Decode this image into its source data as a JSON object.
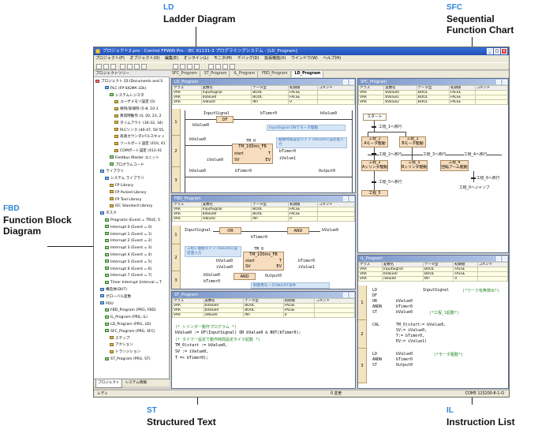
{
  "callouts": {
    "ld": {
      "code": "LD",
      "name": "Ladder Diagram"
    },
    "sfc": {
      "code": "SFC",
      "name_line1": "Sequential",
      "name_line2": "Function Chart"
    },
    "fbd": {
      "code": "FBD",
      "name_line1": "Function Block",
      "name_line2": "Diagram"
    },
    "st": {
      "code": "ST",
      "name": "Structured Text"
    },
    "il": {
      "code": "IL",
      "name": "Instruction List"
    }
  },
  "app": {
    "title": "プロジェクト2.pro - Control FPWIN Pro - IEC 61131-3 プログラミングシステム - [LD_Program]",
    "menu": [
      "プロジェクト(P)",
      "オブジェクト(O)",
      "編集(E)",
      "オンライン(L)",
      "モニタ(M)",
      "デバッグ(D)",
      "拡張機能(X)",
      "ウインドウ(W)",
      "ヘルプ(H)"
    ],
    "panel_title": "プロジェクトツリー",
    "tabs": [
      "SFC_Program",
      "ST_Program",
      "IL_Program",
      "FBD_Program",
      "LD_Program"
    ],
    "active_tab": "LD_Program",
    "tree": [
      "プロジェクト [D:\\Documents and S",
      "PLC (FP-SIGMA 32k)",
      "システムレジスタ",
      "ユーザメモリ設定 (0)",
      "保持/非保持 (5-8, 10-1",
      "異常時動作 (4, 20, 23, 2",
      "タイムアウト (30-32, 34)",
      "PLCリンク (40-47, 50-55,",
      "高速カウンタ/パルスキャッ",
      "ツールポート設定 (410, 41",
      "COMポート設定 (412-41",
      "Fieldbus Master ユニット",
      "プログラムコード",
      "ライブラリ",
      "システム ライブラリ",
      "FP Library",
      "FP Pulsed Library",
      "FP Tool Library",
      "IEC Standard Library",
      "タスク",
      "Programs (Event = TRUE, 5",
      "Interrupt 0 (Event = 0)",
      "Interrupt 1 (Event = 1)",
      "Interrupt 2 (Event = 2)",
      "Interrupt 3 (Event = 3)",
      "Interrupt 4 (Event = 4)",
      "Interrupt 5 (Event = 5)",
      "Interrupt 6 (Event = 6)",
      "Interrupt 7 (Event = 7)",
      "Timer Interrupt (Interval = T",
      "構造体(DUT)",
      "グローバル変数",
      "POU",
      "FBD_Program (PRG, FBD)",
      "IL_Program (PRG, IL)",
      "LD_Program (PRG, LD)",
      "SFC_Program (PRG, SFC)",
      "ステップ",
      "アクション",
      "トランジション",
      "ST_Program (PRG, ST)"
    ],
    "tree_tabs": [
      "プロジェクト",
      "システム情報"
    ],
    "status_left": "レディ",
    "status_mid": "0 変更",
    "status_right": "COM5 115200-8-1-O"
  },
  "var_headers": [
    "クラス",
    "変数名",
    "データ型",
    "初期値",
    "コメント"
  ],
  "ld": {
    "title": "LD_Program",
    "vars": [
      [
        "VAR",
        "InputSignal",
        "BOOL",
        "FALSE",
        ""
      ],
      [
        "VAR",
        "bValue0",
        "BOOL",
        "FALSE",
        ""
      ],
      [
        "VAR",
        "iValue0",
        "INT",
        "0",
        ""
      ]
    ],
    "rungs": [
      "1",
      "2",
      "3"
    ],
    "r1": {
      "a": "InputSignal",
      "fb": "DF",
      "b": "bValue0",
      "c": "bTimer0",
      "out": "bValue0",
      "comment": "InputSignal ONでモータ駆動"
    },
    "r2": {
      "a": "bValue0",
      "fbname": "TM_0",
      "fbtype": "TM_100ms_FB",
      "start": "start",
      "t": "T",
      "sv": "SV",
      "ev": "EV",
      "in": "iValue0",
      "out1": "bTimer0",
      "out2": "iValue1",
      "comment": "駆動時間設定タイマ iValue0に設定値入力"
    },
    "r3": {
      "a": "bValue0",
      "b": "bTimer0",
      "out": "Output0"
    }
  },
  "fbd": {
    "title": "FBD_Program",
    "vars": [
      [
        "VAR",
        "InputSignal",
        "BOOL",
        "FALSE",
        ""
      ],
      [
        "VAR",
        "bValue0",
        "BOOL",
        "FALSE",
        ""
      ],
      [
        "VAR",
        "iValue0",
        "INT",
        "0",
        ""
      ]
    ],
    "rungs": [
      "1",
      "2",
      "3"
    ],
    "r1": {
      "a": "InputSignal",
      "or": "OR",
      "b": "bTimer0",
      "and": "AND",
      "out": "bValue0"
    },
    "r2": {
      "comment": "工程1 駆動タイマ iValue0に設定値入力",
      "fbname": "TM_0",
      "fbtype": "TM_100ms_FB",
      "a": "bValue0",
      "in": "iValue0",
      "start": "start",
      "t": "T",
      "sv": "SV",
      "ev": "EV",
      "out1": "bTimer0",
      "out2": "iValue1"
    },
    "r3": {
      "a": "bValue0",
      "b": "bTimer0",
      "and": "AND",
      "out": "Output0",
      "comment": "制御用モータON/OFF条件"
    }
  },
  "sfc": {
    "title": "SFC_Program",
    "vars": [
      [
        "VAR",
        "bValue0",
        "BOOL",
        "FALSE",
        ""
      ],
      [
        "VAR",
        "bValue1",
        "BOOL",
        "FALSE",
        ""
      ],
      [
        "VAR",
        "bValue2",
        "BOOL",
        "FALSE",
        ""
      ]
    ],
    "start": "スタート",
    "t1": "工程_1へ移行",
    "s1a": "工程_1",
    "s1b": "Aモータ駆動",
    "s1c": "工程_1",
    "s1d": "Bモータ駆動",
    "t2": "工程_2へ移行",
    "t3": "工程_3へ移行",
    "t4": "工程_4へ移行",
    "s2a": "工程_2",
    "s2b": "Aシリンダ駆動",
    "s3a": "工程_3",
    "s3b": "Bシリンダ駆動",
    "s4a": "工程_4",
    "s4b": "回転アーム駆動",
    "t5": "工程_5へ移行",
    "t6": "工程_6へ移行",
    "s5": "工程_5",
    "jump": "工程_0へジャンプ"
  },
  "st": {
    "title": "ST_Program",
    "vars": [
      [
        "VAR",
        "bValue0",
        "BOOL",
        "FALSE",
        ""
      ],
      [
        "VAR",
        "bValue0",
        "BOOL",
        "FALSE",
        ""
      ],
      [
        "VAR",
        "iValue0",
        "INT",
        "0",
        ""
      ]
    ],
    "lines": [
      "(* シリンダー動作プログラム *)",
      "bValue0 := DF(InputSignal) OR bValue0 & NOT(bTimer0);",
      "(* タイマー設定で動作時間設定タイマ起動 *)",
      "TM_0(start := bValue0,",
      "     SV := iValue0,",
      "     T  => bTimer0);"
    ]
  },
  "il": {
    "title": "IL_Program",
    "vars": [
      [
        "VAR",
        "InputSignal",
        "BOOL",
        "FALSE",
        ""
      ],
      [
        "VAR",
        "bValue0",
        "BOOL",
        "FALSE",
        ""
      ],
      [
        "VAR",
        "iValue0",
        "INT",
        "0",
        ""
      ]
    ],
    "rungs": [
      "1",
      "2",
      "3"
    ],
    "r1": {
      "ops": [
        "LD",
        "DF",
        "OR",
        "ANDN",
        "ST"
      ],
      "args": [
        "",
        "",
        "bValue0",
        "bTimer0",
        "bValue0"
      ],
      "main": "InputSignal",
      "c1": "(*ワーク有無検出*)",
      "c2": "(*工程_1起動*)"
    },
    "r2": {
      "op": "CAL",
      "lines": [
        "TM_0(start:= bValue0,",
        "     SV:= iValue0,",
        "     T:= bTimer0,",
        "     EV:= iValue1)"
      ]
    },
    "r3": {
      "ops": [
        "LD",
        "ANDN",
        "ST"
      ],
      "args": [
        "bValue0",
        "bTimer0",
        "Output0"
      ],
      "c1": "(*モータ駆動*)"
    }
  }
}
